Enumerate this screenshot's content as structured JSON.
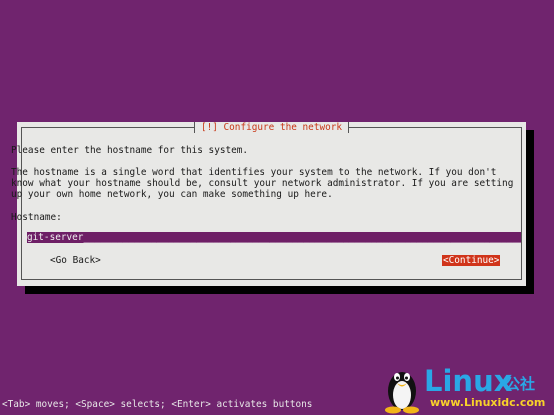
{
  "dialog": {
    "title": "[!] Configure the network",
    "prompt": "Please enter the hostname for this system.",
    "description": "The hostname is a single word that identifies your system to the network. If you don't\nknow what your hostname should be, consult your network administrator. If you are setting\nup your own home network, you can make something up here.",
    "field_label": "Hostname:",
    "hostname_value": "git-server_______________________________________________________________________________",
    "back_button": "<Go Back>",
    "continue_button": "<Continue>"
  },
  "footer": {
    "help": "<Tab> moves; <Space> selects; <Enter> activates buttons"
  },
  "watermark": {
    "logo_word": "Linux",
    "logo_cn": "公社",
    "url": "www.Linuxidc.com"
  },
  "colors": {
    "background": "#70246e",
    "dialog": "#e8e8e6",
    "title": "#c83818",
    "focused_button": "#d0341a",
    "input_bg": "#6e1f66"
  },
  "icons": {
    "logo_mascot": "tux-penguin-icon"
  }
}
